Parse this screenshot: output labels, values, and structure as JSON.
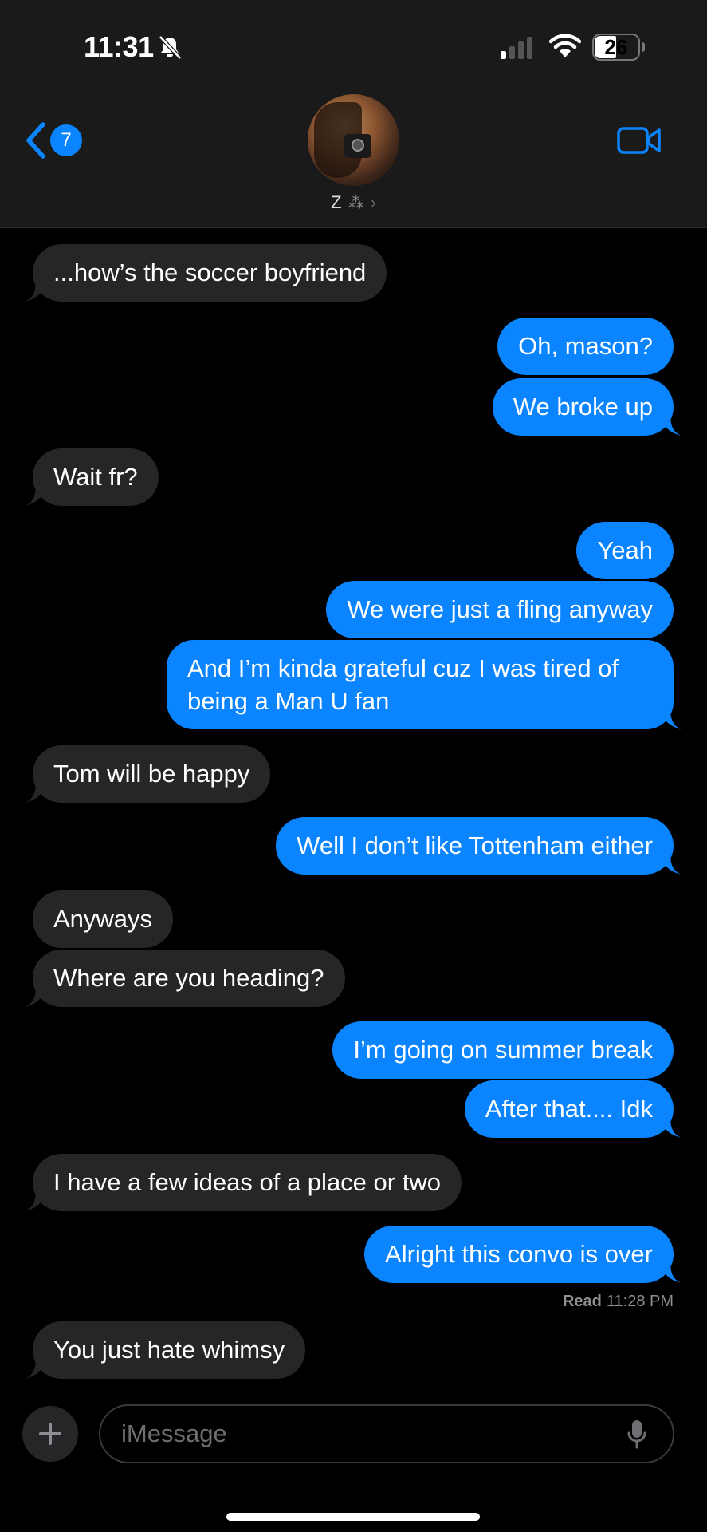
{
  "status_bar": {
    "time": "11:31",
    "battery": "26"
  },
  "header": {
    "back_count": "7",
    "contact_name": "Z",
    "contact_deco": "⁂"
  },
  "messages": [
    {
      "dir": "in",
      "text": "...how’s the soccer boyfriend"
    },
    {
      "dir": "out",
      "text": "Oh, mason?"
    },
    {
      "dir": "out",
      "text": "We broke up"
    },
    {
      "dir": "in",
      "text": "Wait fr?"
    },
    {
      "dir": "out",
      "text": "Yeah"
    },
    {
      "dir": "out",
      "text": "We were just a fling anyway"
    },
    {
      "dir": "out",
      "text": "And I’m kinda grateful cuz I was tired of being a Man U fan"
    },
    {
      "dir": "in",
      "text": "Tom will be happy"
    },
    {
      "dir": "out",
      "text": "Well I don’t like Tottenham either"
    },
    {
      "dir": "in",
      "text": "Anyways"
    },
    {
      "dir": "in",
      "text": "Where are you heading?"
    },
    {
      "dir": "out",
      "text": "I’m going on summer break"
    },
    {
      "dir": "out",
      "text": "After that.... Idk"
    },
    {
      "dir": "in",
      "text": "I have a few ideas of a place or two"
    },
    {
      "dir": "out",
      "text": "Alright this convo is over"
    },
    {
      "dir": "in",
      "text": "You just hate whimsy"
    }
  ],
  "receipt": {
    "label": "Read",
    "time": "11:28 PM"
  },
  "composer": {
    "placeholder": "iMessage"
  },
  "colors": {
    "outgoing": "#0a84ff",
    "incoming": "#262628",
    "background": "#000000"
  }
}
